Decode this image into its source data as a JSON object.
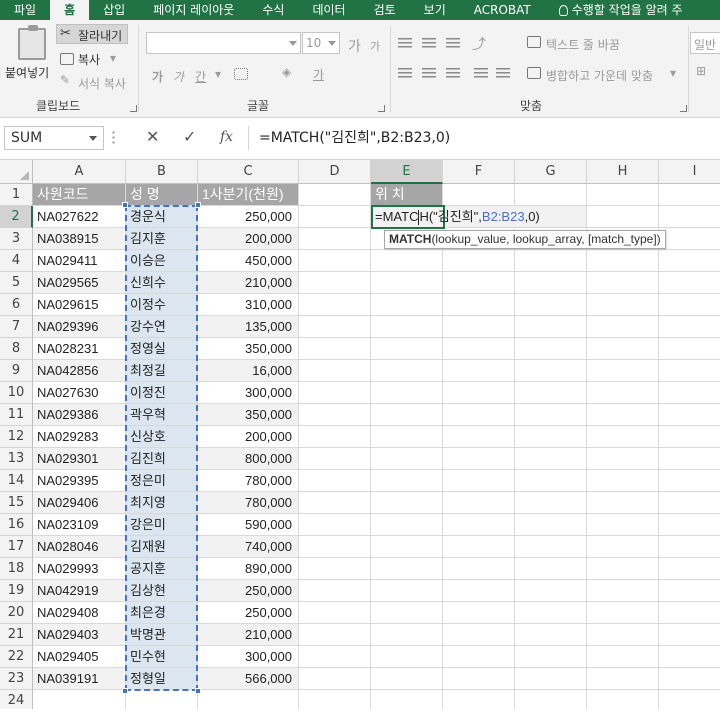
{
  "menu": {
    "tabs": [
      "파일",
      "홈",
      "삽입",
      "페이지 레이아웃",
      "수식",
      "데이터",
      "검토",
      "보기",
      "ACROBAT"
    ],
    "active_tab": "홈",
    "tell_me": "수행할 작업을 알려 주"
  },
  "ribbon": {
    "clipboard": {
      "paste": "붙여넣기",
      "cut": "잘라내기",
      "copy": "복사",
      "format_painter": "서식 복사",
      "label": "클립보드"
    },
    "font": {
      "size": "10",
      "grow": "가",
      "shrink": "가",
      "bold": "가",
      "italic": "가",
      "underline": "간",
      "label": "글꼴"
    },
    "alignment": {
      "wrap_text": "텍스트 줄 바꿈",
      "merge_center": "병합하고 가운데 맞춤",
      "label": "맞춤"
    },
    "number": {
      "format": "일반"
    }
  },
  "formula_bar": {
    "name_box": "SUM",
    "cancel": "✕",
    "enter": "✓",
    "fx": "fx",
    "formula": "=MATCH(\"김진희\",B2:B23,0)"
  },
  "sheet": {
    "columns": [
      "A",
      "B",
      "C",
      "D",
      "E",
      "F",
      "G",
      "H",
      "I"
    ],
    "active_column": "E",
    "active_row": "2",
    "rows": [
      "1",
      "2",
      "3",
      "4",
      "5",
      "6",
      "7",
      "8",
      "9",
      "10",
      "11",
      "12",
      "13",
      "14",
      "15",
      "16",
      "17",
      "18",
      "19",
      "20",
      "21",
      "22",
      "23",
      "24"
    ],
    "headers": {
      "code": "사원코드",
      "name": "성  명",
      "sales": "1사분기(천원)",
      "position": "위 치"
    },
    "data": [
      [
        "NA027622",
        "경운식",
        "250,000"
      ],
      [
        "NA038915",
        "김지훈",
        "200,000"
      ],
      [
        "NA029411",
        "이승은",
        "450,000"
      ],
      [
        "NA029565",
        "신희수",
        "210,000"
      ],
      [
        "NA029615",
        "이정수",
        "310,000"
      ],
      [
        "NA029396",
        "강수연",
        "135,000"
      ],
      [
        "NA028231",
        "정영실",
        "350,000"
      ],
      [
        "NA042856",
        "최정길",
        "16,000"
      ],
      [
        "NA027630",
        "이정진",
        "300,000"
      ],
      [
        "NA029386",
        "곽우혁",
        "350,000"
      ],
      [
        "NA029283",
        "신상호",
        "200,000"
      ],
      [
        "NA029301",
        "김진희",
        "800,000"
      ],
      [
        "NA029395",
        "정은미",
        "780,000"
      ],
      [
        "NA029406",
        "최지영",
        "780,000"
      ],
      [
        "NA023109",
        "강은미",
        "590,000"
      ],
      [
        "NA028046",
        "김재원",
        "740,000"
      ],
      [
        "NA029993",
        "공지훈",
        "890,000"
      ],
      [
        "NA042919",
        "김상현",
        "250,000"
      ],
      [
        "NA029408",
        "최은경",
        "250,000"
      ],
      [
        "NA029403",
        "박명관",
        "210,000"
      ],
      [
        "NA029405",
        "민수현",
        "300,000"
      ],
      [
        "NA039191",
        "정형일",
        "566,000"
      ]
    ],
    "edit": {
      "prefix": "=MATC",
      "after_caret": "H(\"김진희\",",
      "range_ref": "B2:B23",
      "suffix": ",0)"
    },
    "tooltip": {
      "func": "MATCH",
      "args": "(lookup_value, lookup_array, [match_type])"
    }
  }
}
